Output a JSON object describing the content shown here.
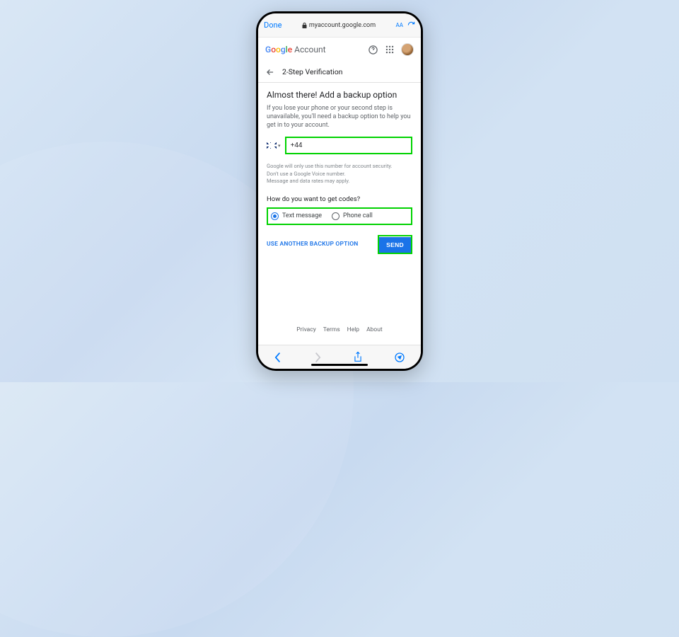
{
  "safari": {
    "done": "Done",
    "url": "myaccount.google.com",
    "textsize": "AA"
  },
  "header": {
    "logo_g": "G",
    "logo_o1": "o",
    "logo_o2": "o",
    "logo_g2": "g",
    "logo_l": "l",
    "logo_e": "e",
    "account": "Account"
  },
  "subheader": {
    "title": "2-Step Verification"
  },
  "page": {
    "title": "Almost there! Add a backup option",
    "desc": "If you lose your phone or your second step is unavailable, you'll need a backup option to help you get in to your account.",
    "phone_value": "+44",
    "legal1": "Google will only use this number for account security.",
    "legal2": "Don't use a Google Voice number.",
    "legal3": "Message and data rates may apply.",
    "question": "How do you want to get codes?",
    "opt_text": "Text message",
    "opt_call": "Phone call",
    "another": "USE ANOTHER BACKUP OPTION",
    "send": "SEND"
  },
  "footer": {
    "privacy": "Privacy",
    "terms": "Terms",
    "help": "Help",
    "about": "About"
  }
}
